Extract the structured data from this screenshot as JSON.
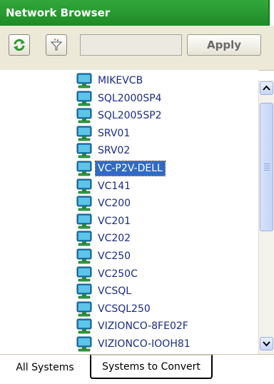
{
  "panel": {
    "title": "Network Browser"
  },
  "toolbar": {
    "refresh_icon": "refresh-icon",
    "filter_icon": "filter-icon",
    "filter_value": "",
    "apply_label": "Apply"
  },
  "systems": [
    {
      "name": "MIKEVCB"
    },
    {
      "name": "SQL2000SP4"
    },
    {
      "name": "SQL2005SP2"
    },
    {
      "name": "SRV01"
    },
    {
      "name": "SRV02"
    },
    {
      "name": "VC-P2V-DELL",
      "selected": true
    },
    {
      "name": "VC141"
    },
    {
      "name": "VC200"
    },
    {
      "name": "VC201"
    },
    {
      "name": "VC202"
    },
    {
      "name": "VC250"
    },
    {
      "name": "VC250C"
    },
    {
      "name": "VCSQL"
    },
    {
      "name": "VCSQL250"
    },
    {
      "name": "VIZIONCO-8FE02F"
    },
    {
      "name": "VIZIONCO-IOOH81"
    }
  ],
  "tabs": [
    {
      "label": "All Systems",
      "active": true
    },
    {
      "label": "Systems to Convert",
      "active": false
    }
  ],
  "colors": {
    "title_bar": "#2a9a32",
    "selection": "#316ac5",
    "item_text": "#1a2a8a"
  }
}
